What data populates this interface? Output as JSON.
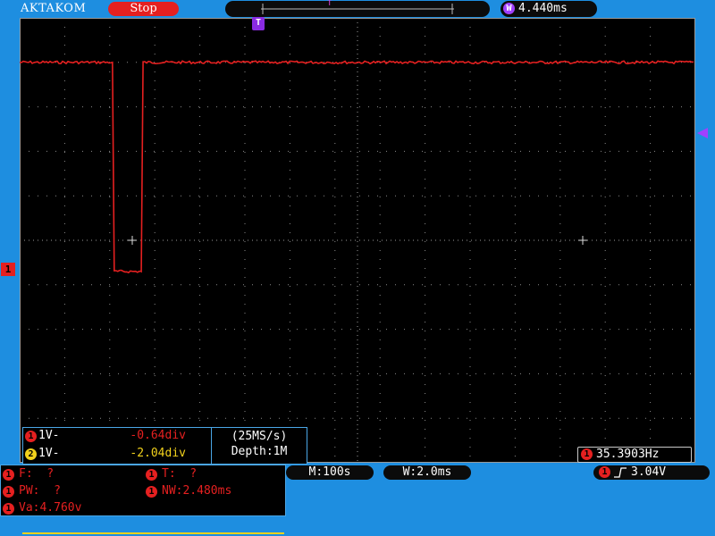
{
  "header": {
    "brand": "AKTAKOM",
    "run_state": "Stop",
    "trigger_top_marker": "T",
    "time_offset": "4.440ms",
    "time_offset_icon": "W",
    "trigger_marker": "T"
  },
  "channel_marker": "1",
  "channels": [
    {
      "badge": "1",
      "scale": "1V-",
      "offset": "-0.64div"
    },
    {
      "badge": "2",
      "scale": "1V-",
      "offset": "-2.04div"
    }
  ],
  "acquisition": {
    "sample_rate": "(25MS/s)",
    "depth": "Depth:1M"
  },
  "frequency": {
    "badge": "1",
    "value": "35.3903Hz"
  },
  "status": {
    "main_timebase": "M:100s",
    "window_timebase": "W:2.0ms",
    "trigger_badge": "1",
    "trigger_level": "3.04V"
  },
  "measurements": {
    "freq": "F:  ?",
    "period": "T:  ?",
    "pos_width": "PW:  ?",
    "neg_width": "NW:2.480ms",
    "amplitude": "Va:4.760v"
  },
  "colors": {
    "ch1": "#e52020",
    "ch2": "#f2d21c",
    "trigger": "#a040ff",
    "background": "#1e8ee0"
  },
  "waveform": {
    "channel": "1",
    "high_level_div": -4.0,
    "low_level_div": 0.7,
    "fall_time_div": 2.06,
    "rise_time_div": 2.7
  }
}
